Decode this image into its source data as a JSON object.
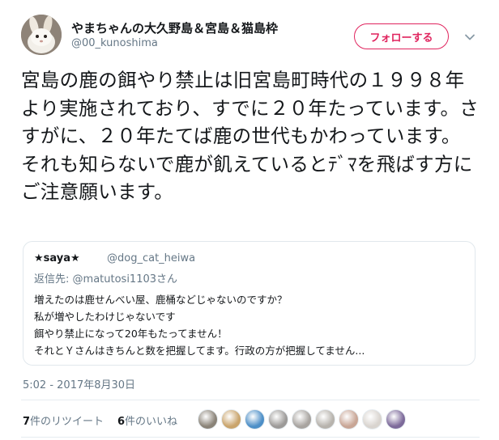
{
  "author": {
    "display_name": "やまちゃんの大久野島＆宮島＆猫島枠",
    "screen_name": "@00_kunoshima",
    "avatar_icon": "rabbit-avatar"
  },
  "follow_button": {
    "label": "フォローする",
    "color": "#e0245e"
  },
  "menu_icon": "chevron-down-icon",
  "tweet_text": "宮島の鹿の餌やり禁止は旧宮島町時代の１９９８年より実施されており、すでに２０年たっています。さすがに、２０年たてば鹿の世代もかわっています。それも知らないで鹿が飢えているとﾃﾞﾏを飛ばす方にご注意願います。",
  "quoted": {
    "name": "★saya★",
    "handle": "@dog_cat_heiwa",
    "reply_prefix": "返信先:",
    "reply_to": "@matutosi1103さん",
    "lines": [
      "増えたのは鹿せんべい屋、鹿桶などじゃないのですか？",
      "私が増やしたわけじゃないです",
      "餌やり禁止になって20年もたってません！",
      "それとＹさんはきちんと数を把握してます。行政の方が把握してません..."
    ]
  },
  "timestamp": "5:02 - 2017年8月30日",
  "stats": {
    "retweets_count": "7",
    "retweets_label": "件のリツイート",
    "likes_count": "6",
    "likes_label": "件のいいね"
  },
  "liker_colors": [
    "#8a8378",
    "#c9a46c",
    "#4d8fc7",
    "#9c9a98",
    "#a8a4a0",
    "#b7b3ad",
    "#c8a595",
    "#d9d4cf",
    "#7d6a9a"
  ]
}
